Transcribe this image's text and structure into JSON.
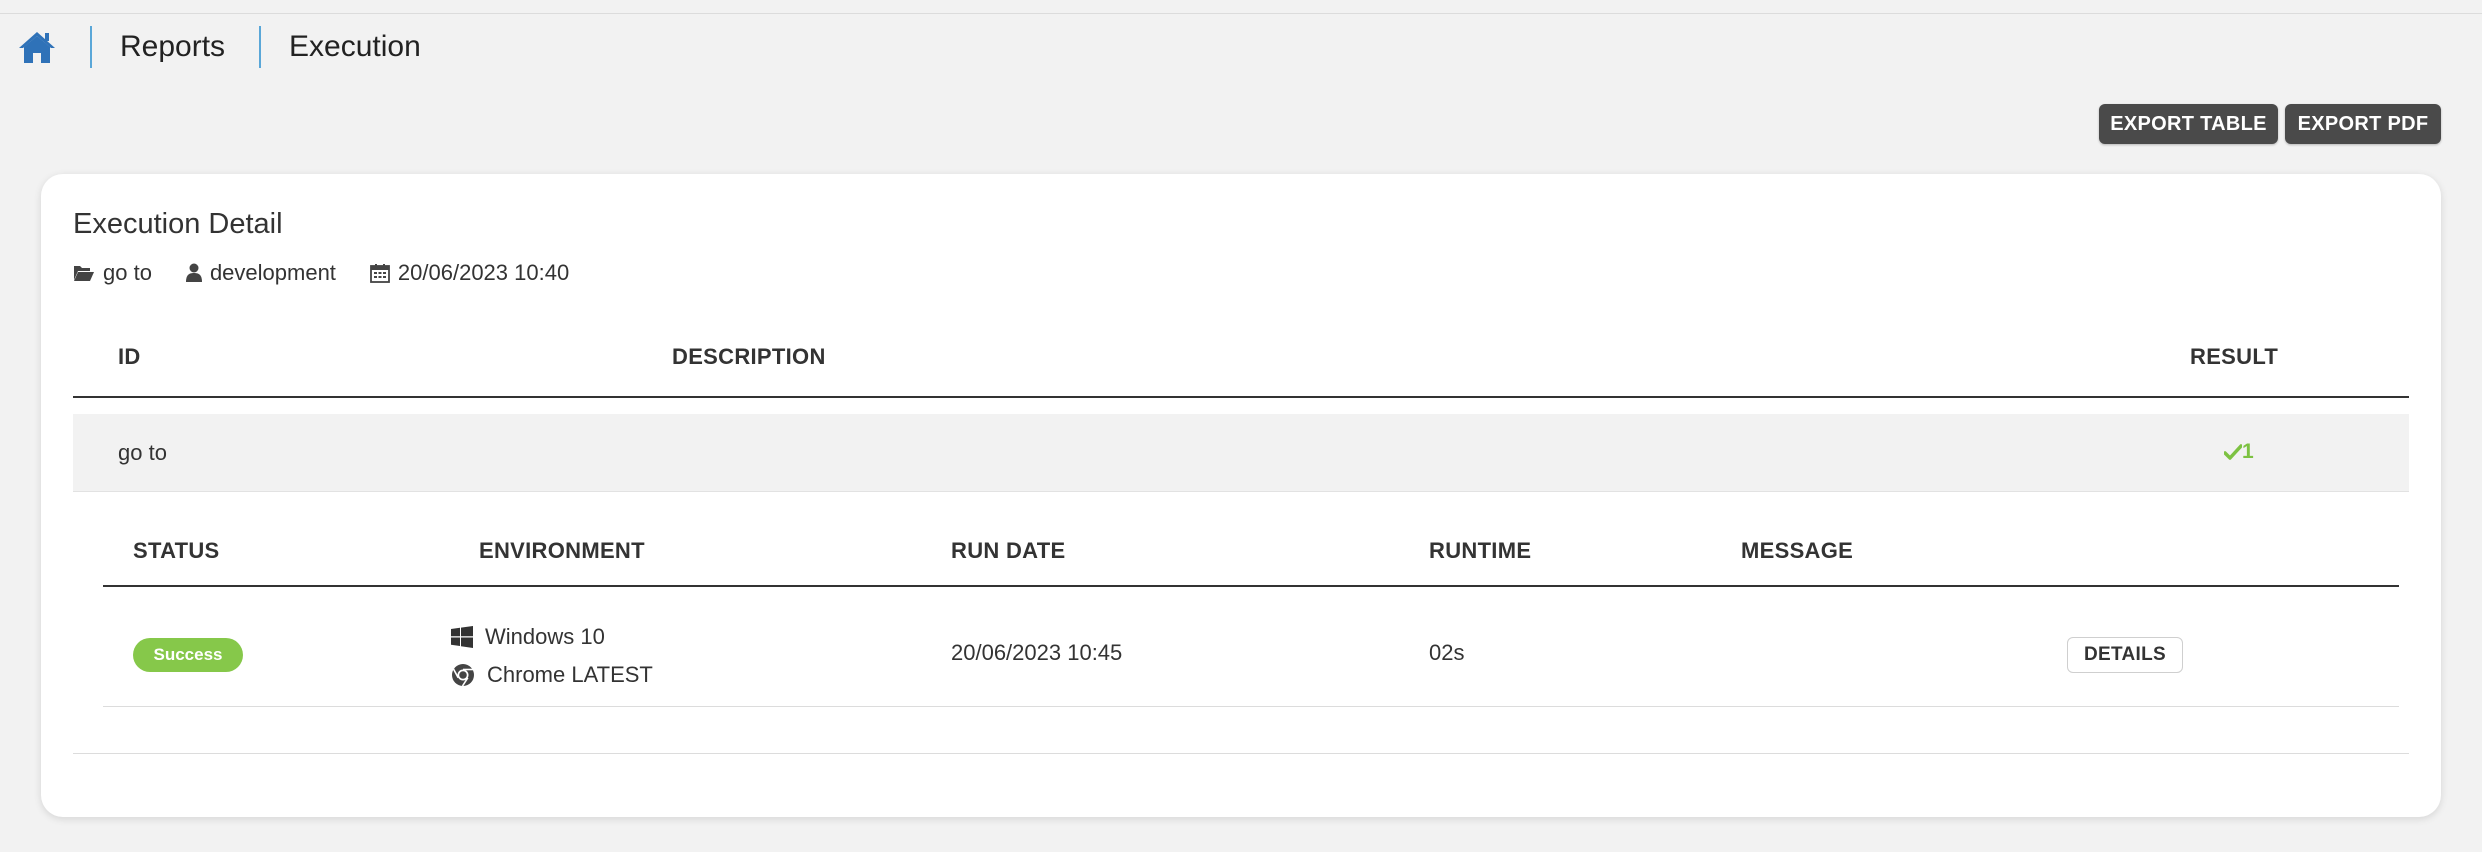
{
  "breadcrumb": {
    "home_icon": "home-icon",
    "items": [
      "Reports",
      "Execution"
    ]
  },
  "toolbar": {
    "export_table_label": "EXPORT TABLE",
    "export_pdf_label": "EXPORT PDF"
  },
  "detail": {
    "title": "Execution Detail",
    "meta": {
      "folder": "go to",
      "user": "development",
      "date": "20/06/2023 10:40"
    }
  },
  "main_table": {
    "headers": {
      "id": "ID",
      "description": "DESCRIPTION",
      "result": "RESULT"
    },
    "rows": [
      {
        "id": "go to",
        "description": "",
        "result_count": "1",
        "result_icon": "check-icon"
      }
    ]
  },
  "sub_table": {
    "headers": {
      "status": "STATUS",
      "environment": "ENVIRONMENT",
      "run_date": "RUN DATE",
      "runtime": "RUNTIME",
      "message": "MESSAGE"
    },
    "rows": [
      {
        "status": "Success",
        "os": "Windows 10",
        "browser": "Chrome LATEST",
        "run_date": "20/06/2023 10:45",
        "runtime": "02s",
        "message": "",
        "action_label": "DETAILS"
      }
    ]
  },
  "colors": {
    "accent_blue": "#2f72b8",
    "separator_blue": "#5aa7d8",
    "success_green": "#86c84a",
    "dark_button": "#4a4a4a"
  }
}
